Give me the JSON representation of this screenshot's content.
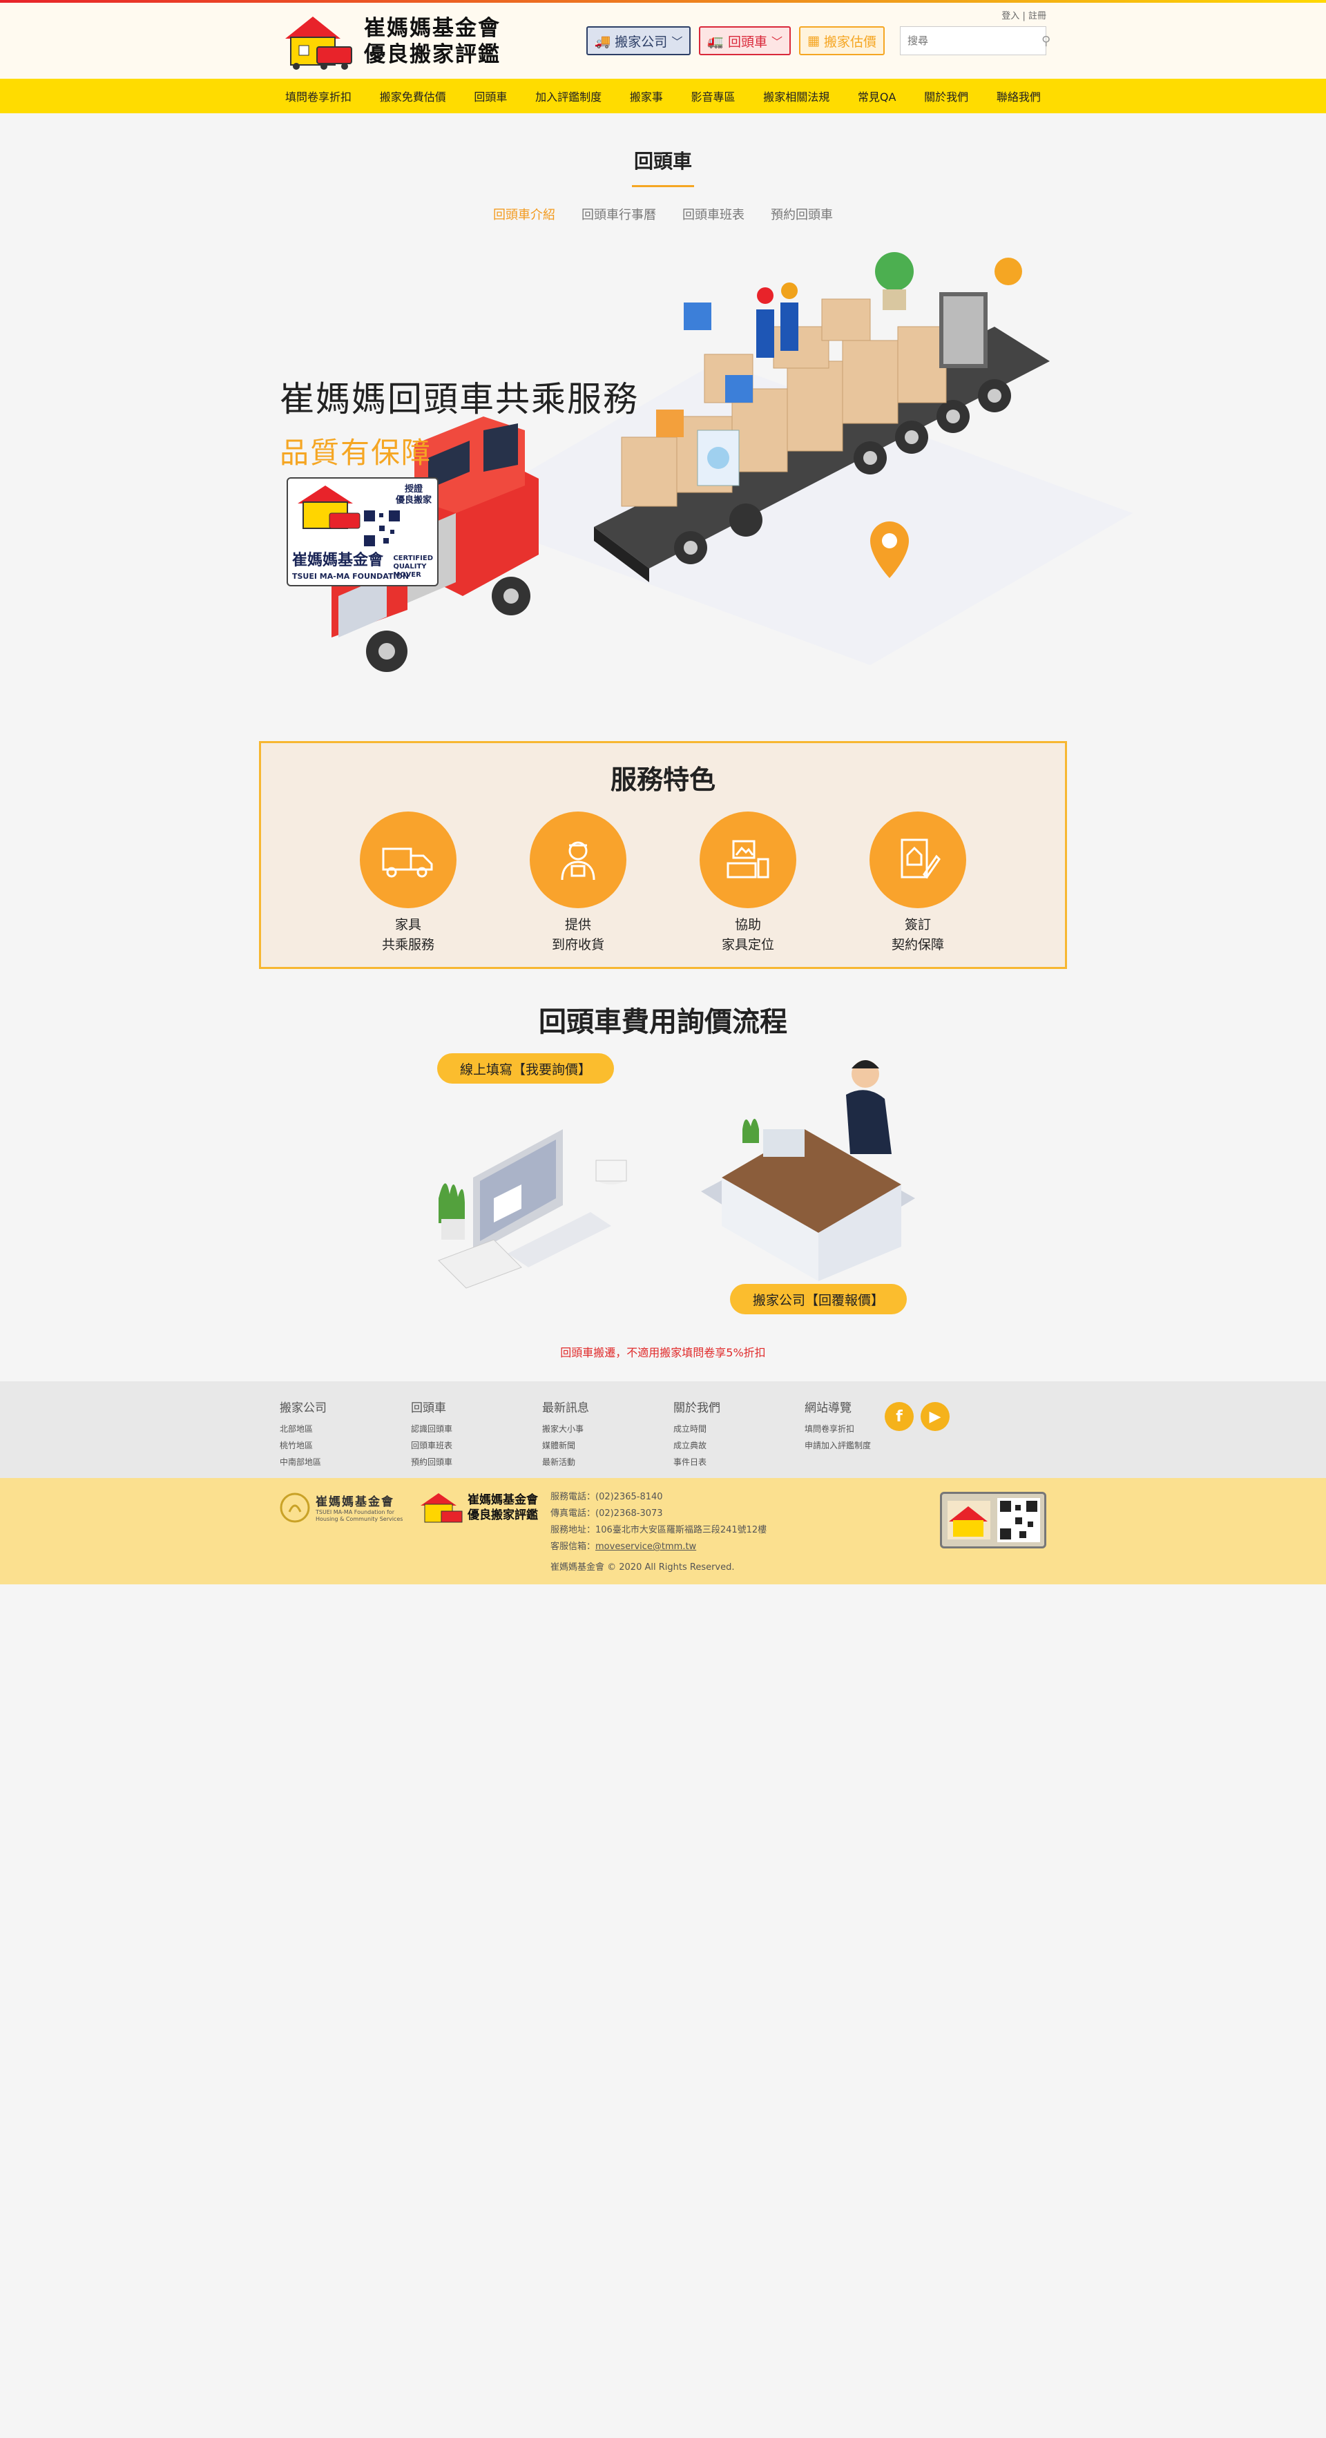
{
  "toplinks": {
    "login": "登入",
    "sep": "|",
    "register": "註冊"
  },
  "logo": {
    "line1": "崔媽媽基金會",
    "line2": "優良搬家評鑑"
  },
  "header_buttons": {
    "movers": "搬家公司",
    "return_truck": "回頭車",
    "estimate": "搬家估價"
  },
  "search": {
    "placeholder": "搜尋"
  },
  "nav": [
    "填問卷享折扣",
    "搬家免費估價",
    "回頭車",
    "加入評鑑制度",
    "搬家事",
    "影音專區",
    "搬家相關法規",
    "常見QA",
    "關於我們",
    "聯絡我們"
  ],
  "page": {
    "title": "回頭車"
  },
  "subtabs": [
    "回頭車介紹",
    "回頭車行事曆",
    "回頭車班表",
    "預約回頭車"
  ],
  "hero": {
    "title": "崔媽媽回頭車共乘服務",
    "subtitle": "品質有保障",
    "badge_name": "崔媽媽基金會",
    "badge_en": "TSUEI MA-MA FOUNDATION",
    "badge_side1": "授證",
    "badge_side2": "優良搬家",
    "badge_cq1": "CERTIFIED",
    "badge_cq2": "QUALITY",
    "badge_cq3": "MOVER"
  },
  "features": {
    "title": "服務特色",
    "items": [
      {
        "line1": "家具",
        "line2": "共乘服務",
        "icon": "truck-icon"
      },
      {
        "line1": "提供",
        "line2": "到府收貨",
        "icon": "worker-icon"
      },
      {
        "line1": "協助",
        "line2": "家具定位",
        "icon": "furniture-icon"
      },
      {
        "line1": "簽訂",
        "line2": "契約保障",
        "icon": "contract-icon"
      }
    ]
  },
  "process": {
    "title": "回頭車費用詢價流程",
    "step1": "線上填寫【我要詢價】",
    "step2": "搬家公司【回覆報價】",
    "note": "回頭車搬遷，不適用搬家填問卷享5%折扣"
  },
  "footer": {
    "cols": [
      {
        "title": "搬家公司",
        "links": [
          "北部地區",
          "桃竹地區",
          "中南部地區"
        ]
      },
      {
        "title": "回頭車",
        "links": [
          "認識回頭車",
          "回頭車班表",
          "預約回頭車"
        ]
      },
      {
        "title": "最新訊息",
        "links": [
          "搬家大小事",
          "媒體新聞",
          "最新活動"
        ]
      },
      {
        "title": "關於我們",
        "links": [
          "成立時間",
          "成立典故",
          "事件日表"
        ]
      },
      {
        "title": "網站導覽",
        "links": [
          "填問卷享折扣",
          "申請加入評鑑制度"
        ]
      }
    ],
    "social": {
      "facebook": "f",
      "youtube": "▶"
    },
    "org_name": "崔媽媽基金會",
    "org_en1": "TSUEI MA-MA Foundation for",
    "org_en2": "Housing & Community Services",
    "logo2_line1": "崔媽媽基金會",
    "logo2_line2": "優良搬家評鑑",
    "phone": "服務電話：(02)2365-8140",
    "fax": "傳真電話：(02)2368-3073",
    "address": "服務地址：106臺北市大安區羅斯福路三段241號12樓",
    "email_label": "客服信箱：",
    "email": "moveservice@tmm.tw",
    "copyright": "崔媽媽基金會 © 2020 All Rights Reserved."
  },
  "colors": {
    "brand_yellow": "#ffdc00",
    "accent_orange": "#f5a623",
    "red": "#d9283a",
    "navy": "#2c3e66"
  }
}
